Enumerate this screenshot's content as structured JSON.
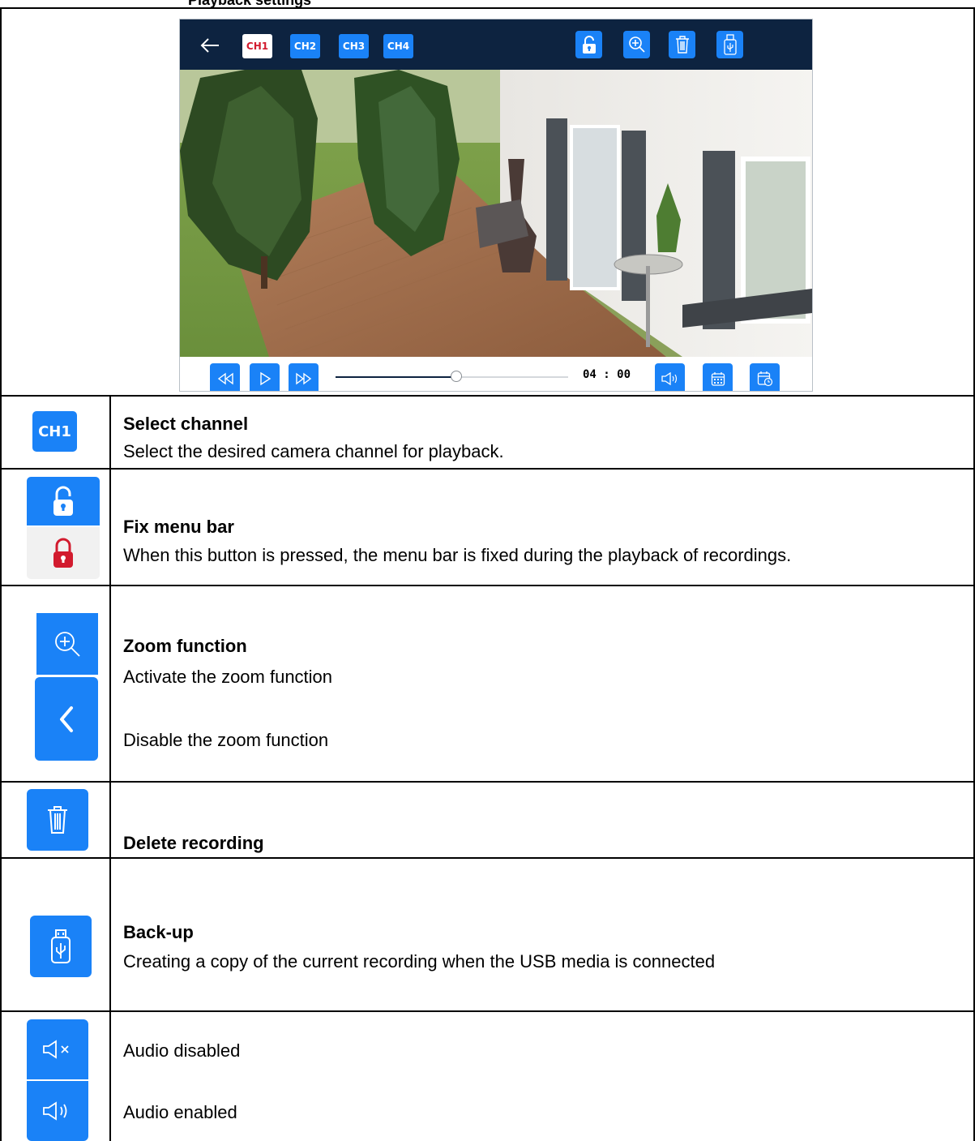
{
  "heading": "Playback settings",
  "device": {
    "channels": [
      "CH1",
      "CH2",
      "CH3",
      "CH4"
    ],
    "active_channel": "CH1",
    "playback_position": 0.52,
    "time_display": "04 : 00",
    "colors": {
      "top_bar": "#0d2340",
      "button": "#1a82f7",
      "active_text": "#d21b2e"
    },
    "top_icons": [
      "back-arrow-icon",
      "lock-icon",
      "zoom-in-icon",
      "trash-icon",
      "usb-icon"
    ],
    "bottom_icons": [
      "rewind-icon",
      "play-icon",
      "fast-forward-icon",
      "speaker-icon",
      "calendar-icon",
      "calendar-clock-icon"
    ]
  },
  "rows": {
    "channel": {
      "icon_label": "CH1",
      "title": "Select channel",
      "text": "Select the desired camera channel for playback."
    },
    "fix": {
      "title": "Fix menu bar",
      "text": "When this button is pressed, the menu bar is fixed during the playback of recordings."
    },
    "zoom": {
      "title": "Zoom function",
      "text1": "Activate the zoom function",
      "text2": "Disable the zoom function"
    },
    "delete": {
      "title": "Delete recording"
    },
    "backup": {
      "title": "Back-up",
      "text": "Creating a copy of the current recording when the USB media is connected"
    },
    "audio": {
      "text1": "Audio disabled",
      "text2": "Audio enabled"
    }
  }
}
